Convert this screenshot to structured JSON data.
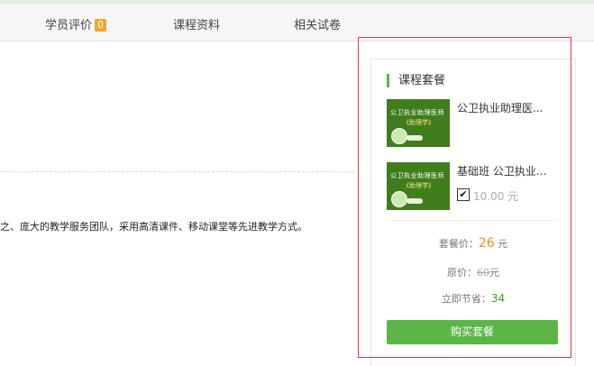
{
  "tabs": [
    {
      "label": "学员评价",
      "badge": "0"
    },
    {
      "label": "课程资料"
    },
    {
      "label": "相关试卷"
    }
  ],
  "description": "之、庞大的教学服务团队，采用高清课件、移动课堂等先进教学方式。",
  "package": {
    "title": "课程套餐",
    "courses": [
      {
        "name": "公卫执业助理医...",
        "thumb_line1": "公卫执业助理医师",
        "thumb_line2": "《助理学》"
      },
      {
        "name": "基础班 公卫执业...",
        "thumb_line1": "公卫执业助理医师",
        "thumb_line2": "《助理学》",
        "checked": true,
        "price": "10.00 元"
      }
    ],
    "package_price_label": "套餐价：",
    "package_price": "26",
    "package_price_unit": " 元",
    "original_label": "原价：",
    "original_price": "60",
    "original_unit": "元",
    "save_label": "立即节省：",
    "save_value": "34",
    "buy_label": "购买套餐"
  },
  "colors": {
    "accent": "#5bb647",
    "price": "#f08c1a",
    "highlight_box": "#e63b3b"
  }
}
